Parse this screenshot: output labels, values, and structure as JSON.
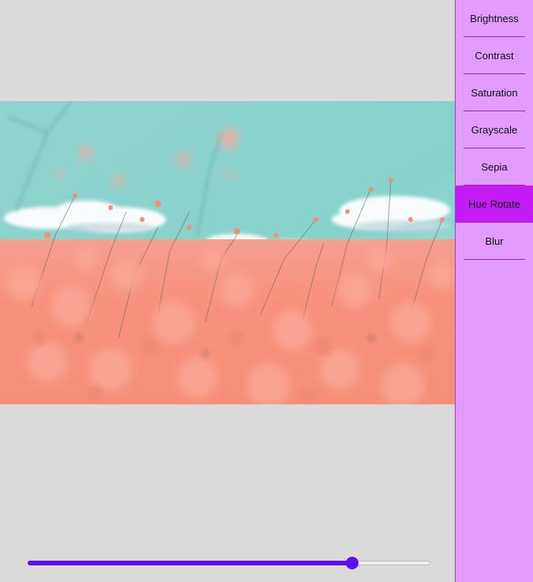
{
  "sidebar": {
    "items": [
      {
        "label": "Brightness"
      },
      {
        "label": "Contrast"
      },
      {
        "label": "Saturation"
      },
      {
        "label": "Grayscale"
      },
      {
        "label": "Sepia"
      },
      {
        "label": "Hue Rotate"
      },
      {
        "label": "Blur"
      }
    ],
    "active_index": 5
  },
  "preview": {
    "image_description_icon": "photo-icon"
  },
  "slider": {
    "value_fraction": 0.806
  },
  "colors": {
    "accent": "#5b10ea",
    "sidebar_bg": "#e19cfd",
    "sidebar_active": "#c51cf5",
    "canvas_bg": "#dadada"
  }
}
